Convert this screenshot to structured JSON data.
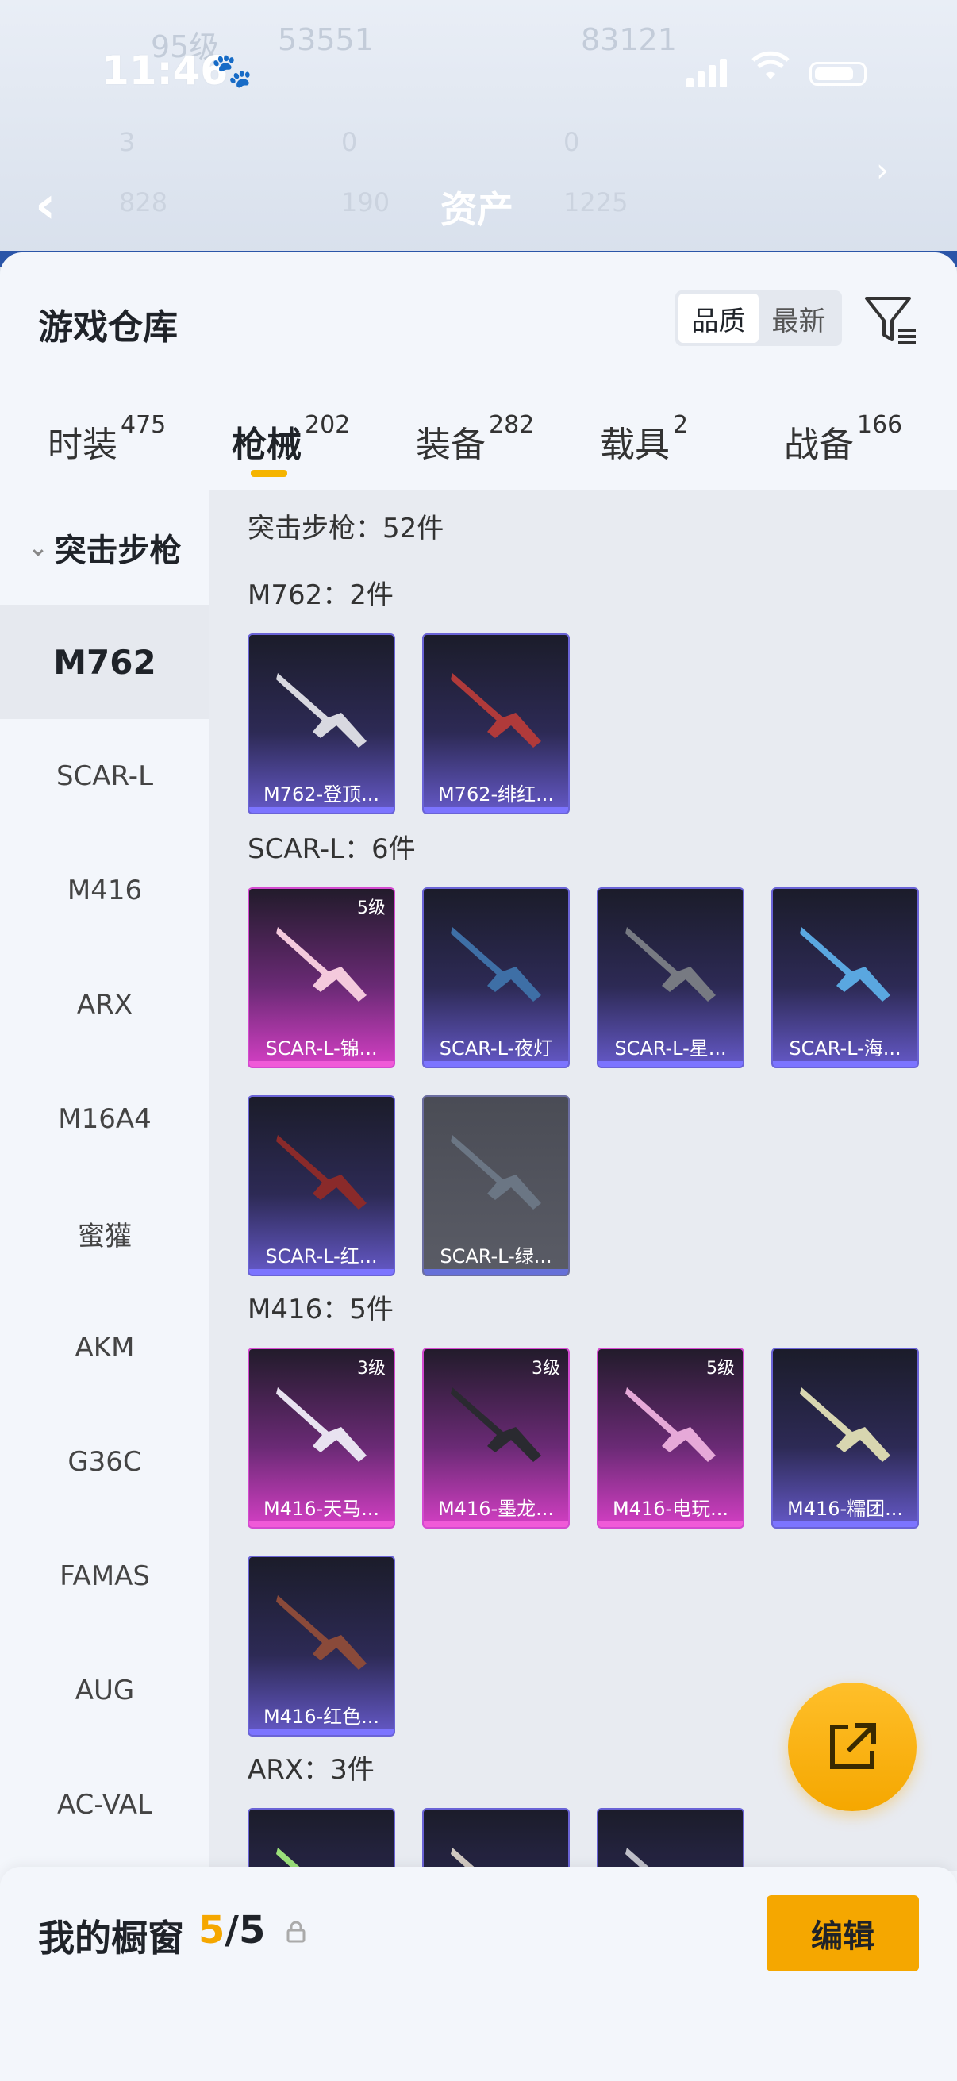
{
  "status": {
    "time": "11:46"
  },
  "nav": {
    "title": "资产",
    "stats": [
      "3",
      "0",
      "0",
      "828",
      "190",
      "1225"
    ],
    "ghost_level": "95级",
    "ghost_score": "53551",
    "ghost_id": "83121"
  },
  "sheet": {
    "title": "游戏仓库",
    "sort_quality": "品质",
    "sort_new": "最新"
  },
  "tabs": [
    {
      "label": "时装",
      "count": "475"
    },
    {
      "label": "枪械",
      "count": "202"
    },
    {
      "label": "装备",
      "count": "282"
    },
    {
      "label": "载具",
      "count": "2"
    },
    {
      "label": "战备",
      "count": "166"
    }
  ],
  "sidebar": {
    "category": "突击步枪",
    "items": [
      "M762",
      "SCAR-L",
      "M416",
      "ARX",
      "M16A4",
      "蜜獾",
      "AKM",
      "G36C",
      "FAMAS",
      "AUG",
      "AC-VAL"
    ]
  },
  "content": {
    "summary": "突击步枪：52件",
    "sections": [
      {
        "title": "M762：2件",
        "items": [
          {
            "name": "M762-登顶...",
            "level": ""
          },
          {
            "name": "M762-绯红...",
            "level": ""
          }
        ]
      },
      {
        "title": "SCAR-L：6件",
        "items": [
          {
            "name": "SCAR-L-锦...",
            "level": "5级"
          },
          {
            "name": "SCAR-L-夜灯",
            "level": ""
          },
          {
            "name": "SCAR-L-星...",
            "level": ""
          },
          {
            "name": "SCAR-L-海...",
            "level": ""
          },
          {
            "name": "SCAR-L-红...",
            "level": ""
          },
          {
            "name": "SCAR-L-绿...",
            "level": ""
          }
        ]
      },
      {
        "title": "M416：5件",
        "items": [
          {
            "name": "M416-天马...",
            "level": "3级"
          },
          {
            "name": "M416-墨龙...",
            "level": "3级"
          },
          {
            "name": "M416-电玩...",
            "level": "5级"
          },
          {
            "name": "M416-糯团...",
            "level": ""
          },
          {
            "name": "M416-红色...",
            "level": ""
          }
        ]
      },
      {
        "title": "ARX：3件",
        "items": []
      }
    ]
  },
  "bottom": {
    "title": "我的橱窗",
    "count_current": "5",
    "count_sep_total": "/5",
    "edit_label": "编辑"
  }
}
